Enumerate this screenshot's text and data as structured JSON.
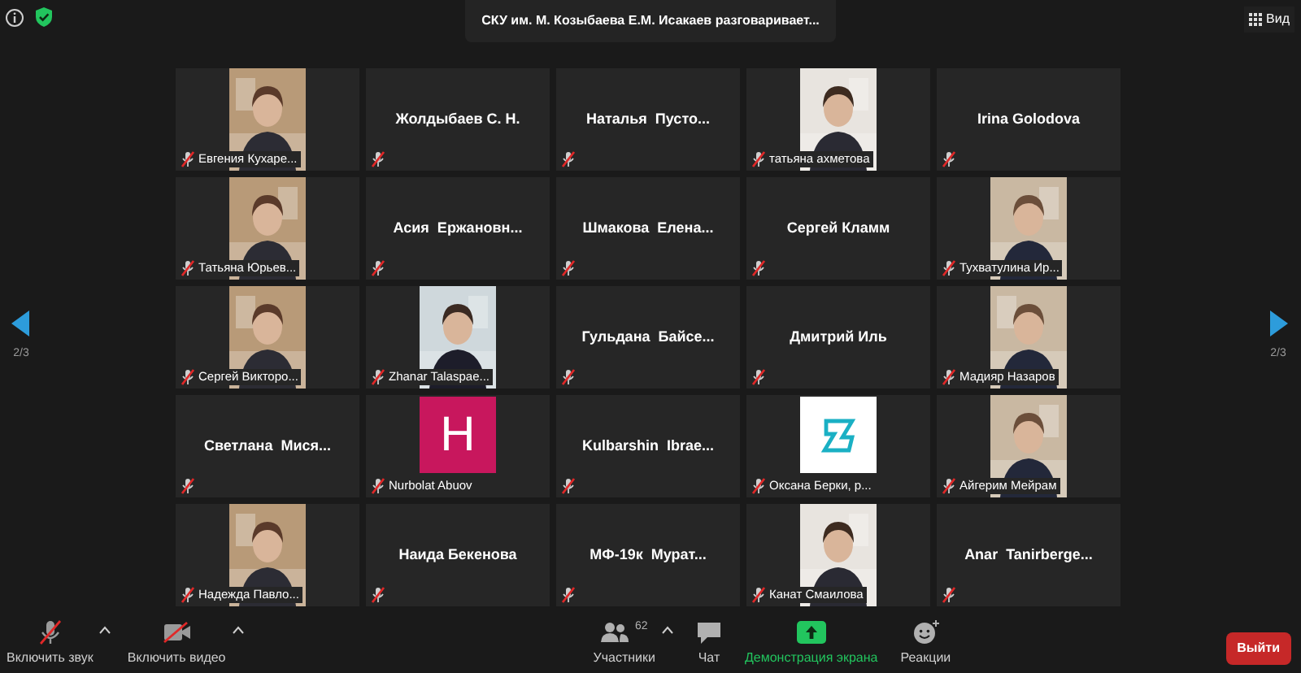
{
  "top_bar": {
    "meeting_title": "СКУ им. М. Козыбаева Е.М. Исакаев разговаривает...",
    "view_button": "Вид"
  },
  "pager": {
    "previous": "2/3",
    "next": "2/3"
  },
  "tiles": [
    {
      "name": "Евгения Кухаре...",
      "muted": true
    },
    {
      "kind": "name",
      "name": "Жолдыбаев С. Н.",
      "muted": true
    },
    {
      "kind": "name",
      "name": "Наталья  Пусто...",
      "muted": true
    },
    {
      "name": "татьяна ахметова",
      "muted": true
    },
    {
      "kind": "name",
      "name": "Irina Golodova",
      "muted": true
    },
    {
      "name": "Татьяна Юрьев...",
      "muted": true
    },
    {
      "kind": "name",
      "name": "Асия  Ержановн...",
      "muted": true
    },
    {
      "kind": "name",
      "name": "Шмакова  Елена...",
      "muted": true
    },
    {
      "kind": "name",
      "name": "Сергей Кламм",
      "muted": true
    },
    {
      "name": "Тухватулина Ир...",
      "muted": true
    },
    {
      "name": "Сергей Викторо...",
      "muted": true
    },
    {
      "name": "Zhanar Talaspae...",
      "muted": true
    },
    {
      "kind": "name",
      "name": "Гульдана  Байсе...",
      "muted": true
    },
    {
      "kind": "name",
      "name": "Дмитрий Иль",
      "muted": true
    },
    {
      "name": "Мадияр Назаров",
      "muted": true
    },
    {
      "kind": "name",
      "name": "Светлана  Мися...",
      "muted": true
    },
    {
      "kind": "letter",
      "letter": "H",
      "name": "Nurbolat Abuov",
      "muted": true
    },
    {
      "kind": "name",
      "name": "Kulbarshin  Ibrae...",
      "muted": true
    },
    {
      "kind": "logo",
      "name": "Оксана Берки, р...",
      "muted": true
    },
    {
      "name": "Айгерим Мейрам",
      "muted": true
    },
    {
      "name": "Надежда Павло...",
      "muted": true
    },
    {
      "kind": "name",
      "name": "Наида Бекенова",
      "muted": true
    },
    {
      "kind": "name",
      "name": "МФ-19к  Мурат...",
      "muted": true
    },
    {
      "name": "Канат Смаилова",
      "muted": true
    },
    {
      "kind": "name",
      "name": "Anar  Tanirberge...",
      "muted": true
    }
  ],
  "toolbar": {
    "items": [
      {
        "kind": "mic",
        "label": "Включить звук",
        "caret": true
      },
      {
        "kind": "video",
        "label": "Включить видео",
        "caret": true
      },
      {
        "kind": "participants",
        "label": "Участники",
        "count": "62",
        "caret": true
      },
      {
        "kind": "chat",
        "label": "Чат",
        "caret": false
      },
      {
        "kind": "share",
        "label": "Демонстрация экрана",
        "caret": false
      },
      {
        "kind": "reactions",
        "label": "Реакции",
        "caret": false
      }
    ],
    "leave_button": "Выйти"
  }
}
